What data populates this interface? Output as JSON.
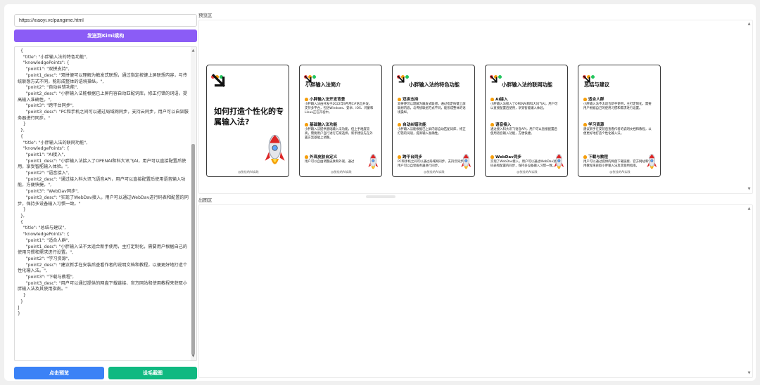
{
  "left": {
    "url_value": "https://xiaoyi.vc/pangime.html",
    "send_button": "发送到Kimi续构",
    "code_text": "  {\n    \"title\": \"小胖输入法的特色功能\",\n    \"knowledgePoints\": {\n      \"point1\": \"双拼支持\",\n      \"point1_desc\": \"双拼便可以理解为触发式联想，通过指定按键上屏联想内容，与传统联想方式不同，能形成整体的语境操纵。\",\n      \"point2\": \"自动纠错功能\",\n      \"point2_desc\": \"小胖输入法能根据已上屏内容自动匹配词库，修正打错的词语，提高输入准确性。\",\n      \"point3\": \"跨平台同步\",\n      \"point3_desc\": \"PC和手机之间可以通过局域网同步，支持云同步，用户可以自架服务器进行同步。\"\n    }\n  },\n  {\n    \"title\": \"小胖输入法的联网功能\",\n    \"knowledgePoints\": {\n      \"point1\": \"AI接入\",\n      \"point1_desc\": \"小胖输入法接入了OPENAI和科大讯飞AI，用户可以直接配置后使用，享受智能输入体验。\",\n      \"point2\": \"语音接入\",\n      \"point2_desc\": \"通过接入科大讯飞语音API，用户可以直接配置后使用语音输入功能，方便快捷。\",\n      \"point3\": \"WebDav同步\",\n      \"point3_desc\": \"实现了WebDav接入，用户可以通过WebDav进行码表和配置的同步，保持多设备输入习惯一致。\"\n    }\n  },\n  {\n    \"title\": \"总结与建议\",\n    \"knowledgePoints\": {\n      \"point1\": \"适合人群\",\n      \"point1_desc\": \"小胖输入法不太适合新手使用，主打定制化，需要用户根据自己的使用习惯和需求进行设置。\",\n      \"point2\": \"学习资源\",\n      \"point2_desc\": \"建议新手在安装后查看作者的说明文档和教程，以便更好地打造个性化输入法。\",\n      \"point3\": \"下载与教程\",\n      \"point3_desc\": \"用户可以通过提供的网盘下载链接、官方网站和使用教程来获取小胖输入法及其使用指南。\"\n    }\n  }\n]\n}",
    "preview_button": "点击预览",
    "generate_button": "设毛截图"
  },
  "right": {
    "preview_label": "预览区",
    "output_label": "出图区"
  },
  "colors": {
    "purple": "#8b5cf6",
    "blue": "#3b82f6",
    "green": "#10b981",
    "dot_red": "#ef4444",
    "dot_yellow": "#f59e0b",
    "dot_green": "#22c55e"
  },
  "cards": [
    {
      "kind": "cover",
      "title": "如何打造个性化的专属输入法?",
      "footer": "@张佳的AI实践",
      "points": []
    },
    {
      "kind": "content",
      "title": "小胖输入法简介",
      "footer": "@张佳的AI实践",
      "points": [
        {
          "h": "小胖输入法开发背景",
          "d": "小胖输入法由开发于2022年9月用C#语言开发，支持多平台，包括Windows、安卓、iOS、鸿蒙和Linux正在开发中。"
        },
        {
          "h": "基础输入法功能",
          "d": "小胖输入法提供基础输入法功能，但上手难度较高，需要用户自行进行方案选择，新手建议先在外置方案基础上调整。"
        },
        {
          "h": "外观皮肤自定义",
          "d": "用户可以自由调整皮肤和外观，通过"
        }
      ]
    },
    {
      "kind": "content",
      "title": "小胖输入法的特色功能",
      "footer": "@张佳的AI实践",
      "points": [
        {
          "h": "双拼支持",
          "d": "双拼便可以理解为触发式联想，通过指定按键上屏联想内容，与传统联想方式不同，能形成整体的语境操纵。"
        },
        {
          "h": "自动纠错功能",
          "d": "小胖输入法能根据已上屏内容自动匹配词库，修正打错的词语，提高输入准确性。"
        },
        {
          "h": "跨平台同步",
          "d": "PC和手机之间可以通过局域网同步，支持云同步，用户可以自架服务器进行同步。"
        }
      ]
    },
    {
      "kind": "content",
      "title": "小胖输入法的联网功能",
      "footer": "@张佳的AI实践",
      "points": [
        {
          "h": "AI接入",
          "d": "小胖输入法接入了OPENAI和科大讯飞AI，用户可以直接配置后使用，享受智能输入体验。"
        },
        {
          "h": "语音接入",
          "d": "通过接入科大讯飞语音API，用户可以直接配置后使用语音输入功能，方便快捷。"
        },
        {
          "h": "WebDav同步",
          "d": "实现了WebDav接入，用户可以通过WebDav进行码表和配置的同步，保持多设备输入习惯一致。"
        }
      ]
    },
    {
      "kind": "content",
      "title": "总结与建议",
      "footer": "@张佳的AI实践",
      "points": [
        {
          "h": "适合人群",
          "d": "小胖输入法不太适合新手使用，主打定制化，需要用户根据自己的使用习惯和需求进行设置。"
        },
        {
          "h": "学习资源",
          "d": "建议新手在安装后查看作者的说明文档和教程，以便更好地打造个性化输入法。"
        },
        {
          "h": "下载与教程",
          "d": "用户可以通过提供的网盘下载链接、官方网站和使用教程来获取小胖输入法及其使用指南。"
        }
      ]
    }
  ]
}
